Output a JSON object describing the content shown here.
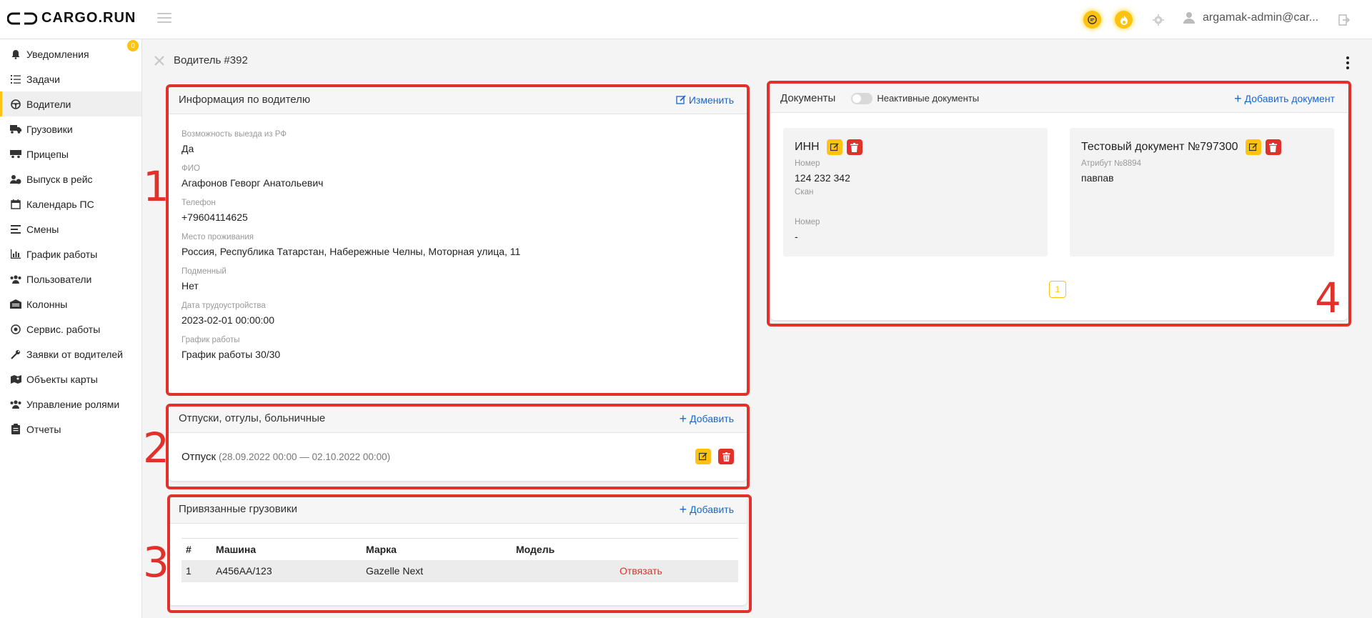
{
  "app": {
    "name": "CARGO.RUN"
  },
  "topbar": {
    "user": "argamak-admin@car..."
  },
  "sidebar": {
    "notif_badge": "0",
    "items": [
      {
        "label": "Уведомления"
      },
      {
        "label": "Задачи"
      },
      {
        "label": "Водители"
      },
      {
        "label": "Грузовики"
      },
      {
        "label": "Прицепы"
      },
      {
        "label": "Выпуск в рейс"
      },
      {
        "label": "Календарь ПС"
      },
      {
        "label": "Смены"
      },
      {
        "label": "График работы"
      },
      {
        "label": "Пользователи"
      },
      {
        "label": "Колонны"
      },
      {
        "label": "Сервис. работы"
      },
      {
        "label": "Заявки от водителей"
      },
      {
        "label": "Объекты карты"
      },
      {
        "label": "Управление ролями"
      },
      {
        "label": "Отчеты"
      }
    ]
  },
  "page": {
    "title": "Водитель #392"
  },
  "info": {
    "title": "Информация по водителю",
    "edit_label": "Изменить",
    "fields": [
      {
        "label": "Возможность выезда из РФ",
        "value": "Да"
      },
      {
        "label": "ФИО",
        "value": "Агафонов Геворг Анатольевич"
      },
      {
        "label": "Телефон",
        "value": "+79604114625"
      },
      {
        "label": "Место проживания",
        "value": "Россия, Республика Татарстан, Набережные Челны, Моторная улица, 11"
      },
      {
        "label": "Подменный",
        "value": "Нет"
      },
      {
        "label": "Дата трудоустройства",
        "value": "2023-02-01 00:00:00"
      },
      {
        "label": "График работы",
        "value": "График работы 30/30"
      }
    ]
  },
  "leaves": {
    "title": "Отпуски, отгулы, больничные",
    "add_label": "Добавить",
    "item_type": "Отпуск",
    "item_period": "(28.09.2022 00:00 — 02.10.2022 00:00)"
  },
  "trucks": {
    "title": "Привязанные грузовики",
    "add_label": "Добавить",
    "columns": [
      "#",
      "Машина",
      "Марка",
      "Модель"
    ],
    "rows": [
      {
        "num": "1",
        "car": "А456АА/123",
        "brand": "Gazelle Next",
        "model": "",
        "action": "Отвязать"
      }
    ]
  },
  "documents": {
    "title": "Документы",
    "toggle_label": "Неактивные документы",
    "add_label": "Добавить документ",
    "page": "1",
    "cards": [
      {
        "title": "ИНН",
        "l1": "Номер",
        "v1": "124 232 342",
        "l2": "Скан",
        "l3": "Номер",
        "v3": "-"
      },
      {
        "title": "Тестовый документ №797300",
        "l1": "Атрибут №8894",
        "v1": "павпав"
      }
    ]
  },
  "annotations": [
    "1",
    "2",
    "3",
    "4"
  ],
  "colors": {
    "accent": "#ffc20e",
    "annotation": "#e0322a",
    "link": "#1a66c9",
    "danger": "#e0322a"
  }
}
